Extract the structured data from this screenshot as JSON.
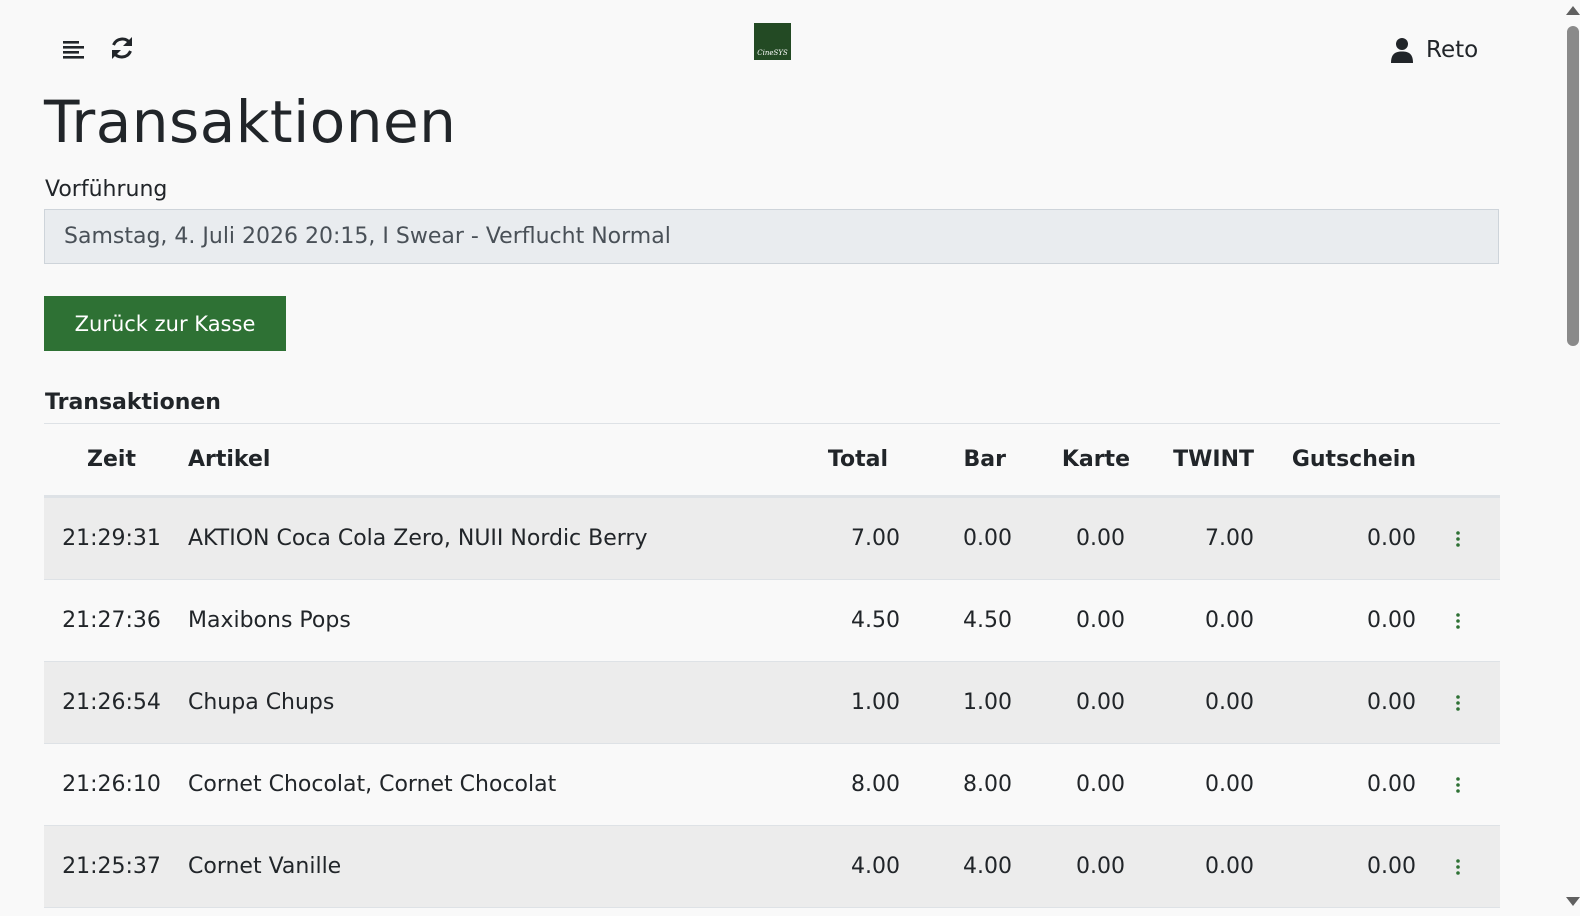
{
  "header": {
    "logo_text": "CineSYS",
    "user_name": "Reto"
  },
  "page": {
    "title": "Transaktionen",
    "field_label": "Vorführung",
    "field_value": "Samstag, 4. Juli 2026 20:15, I Swear - Verflucht Normal",
    "back_button": "Zurück zur Kasse",
    "section_title": "Transaktionen"
  },
  "table": {
    "columns": {
      "zeit": "Zeit",
      "artikel": "Artikel",
      "total": "Total",
      "bar": "Bar",
      "karte": "Karte",
      "twint": "TWINT",
      "gutschein": "Gutschein"
    },
    "rows": [
      {
        "zeit": "21:29:31",
        "artikel": "AKTION Coca Cola Zero, NUII Nordic Berry",
        "total": "7.00",
        "bar": "0.00",
        "karte": "0.00",
        "twint": "7.00",
        "gutschein": "0.00"
      },
      {
        "zeit": "21:27:36",
        "artikel": "Maxibons Pops",
        "total": "4.50",
        "bar": "4.50",
        "karte": "0.00",
        "twint": "0.00",
        "gutschein": "0.00"
      },
      {
        "zeit": "21:26:54",
        "artikel": "Chupa Chups",
        "total": "1.00",
        "bar": "1.00",
        "karte": "0.00",
        "twint": "0.00",
        "gutschein": "0.00"
      },
      {
        "zeit": "21:26:10",
        "artikel": "Cornet Chocolat, Cornet Chocolat",
        "total": "8.00",
        "bar": "8.00",
        "karte": "0.00",
        "twint": "0.00",
        "gutschein": "0.00"
      },
      {
        "zeit": "21:25:37",
        "artikel": "Cornet Vanille",
        "total": "4.00",
        "bar": "4.00",
        "karte": "0.00",
        "twint": "0.00",
        "gutschein": "0.00"
      }
    ]
  },
  "colors": {
    "accent": "#2e7134",
    "logo_bg": "#234a24",
    "row_stripe": "#ececec",
    "background": "#f9f9f9"
  },
  "icons": {
    "menu": "menu-lines-icon",
    "refresh": "refresh-icon",
    "user": "user-icon",
    "row_actions": "kebab-menu-icon"
  }
}
